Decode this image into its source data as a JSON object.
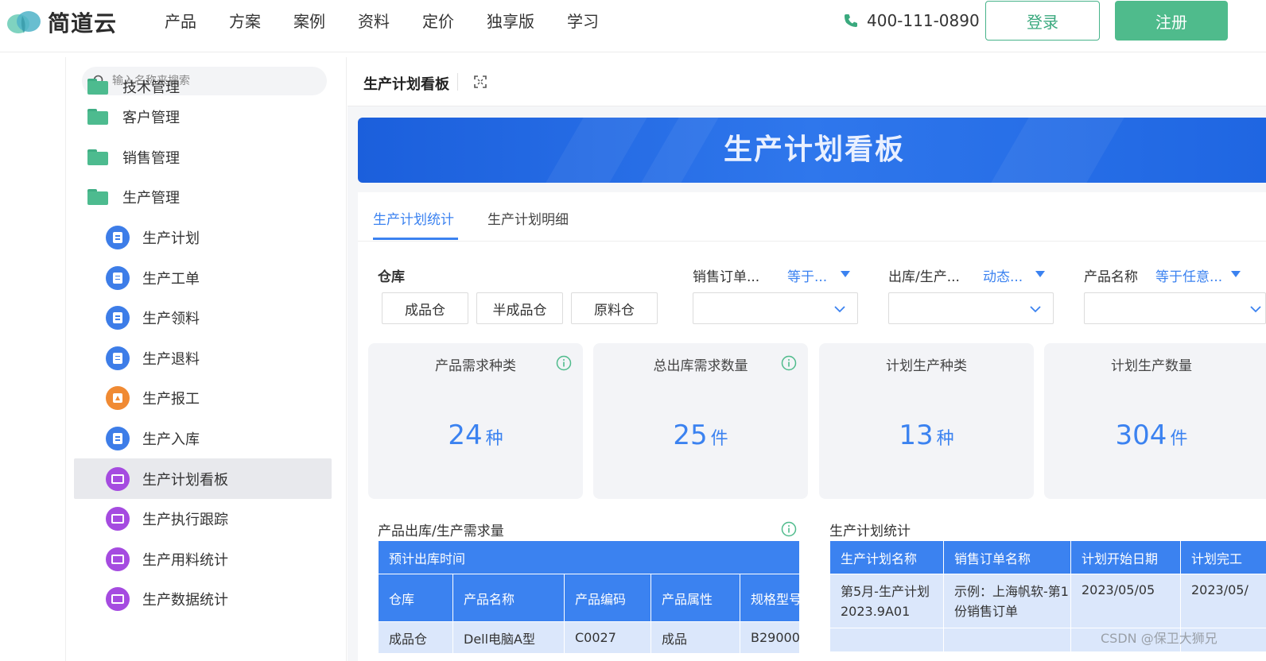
{
  "brand": {
    "name": "简道云"
  },
  "nav": [
    "产品",
    "方案",
    "案例",
    "资料",
    "定价",
    "独享版",
    "学习"
  ],
  "header": {
    "phone": "400-111-0890",
    "login": "登录",
    "register": "注册"
  },
  "sidebar": {
    "search_placeholder": "输入名称来搜索",
    "cutoff_label": "技术管理",
    "folders": [
      "客户管理",
      "销售管理",
      "生产管理"
    ],
    "items": [
      {
        "label": "生产计划",
        "icon": "document-icon",
        "color": "#3d7de8"
      },
      {
        "label": "生产工单",
        "icon": "document-icon",
        "color": "#3d7de8"
      },
      {
        "label": "生产领料",
        "icon": "document-icon",
        "color": "#3d7de8"
      },
      {
        "label": "生产退料",
        "icon": "document-icon",
        "color": "#3d7de8"
      },
      {
        "label": "生产报工",
        "icon": "report-icon",
        "color": "#f08a33"
      },
      {
        "label": "生产入库",
        "icon": "document-icon",
        "color": "#3d7de8"
      },
      {
        "label": "生产计划看板",
        "icon": "dashboard-icon",
        "color": "#a54be0",
        "active": true
      },
      {
        "label": "生产执行跟踪",
        "icon": "dashboard-icon",
        "color": "#a54be0"
      },
      {
        "label": "生产用料统计",
        "icon": "dashboard-icon",
        "color": "#a54be0"
      },
      {
        "label": "生产数据统计",
        "icon": "dashboard-icon",
        "color": "#a54be0"
      }
    ]
  },
  "page": {
    "title": "生产计划看板",
    "banner_title": "生产计划看板",
    "tabs": [
      "生产计划统计",
      "生产计划明细"
    ],
    "active_tab": 0
  },
  "filters": {
    "warehouse_label": "仓库",
    "warehouse_options": [
      "成品仓",
      "半成品仓",
      "原料仓"
    ],
    "sales_order": {
      "label": "销售订单...",
      "op": "等于..."
    },
    "outbound": {
      "label": "出库/生产...",
      "op": "动态..."
    },
    "product_name": {
      "label": "产品名称",
      "op": "等于任意..."
    }
  },
  "cards": [
    {
      "title": "产品需求种类",
      "value": "24",
      "unit": "种",
      "info": true
    },
    {
      "title": "总出库需求数量",
      "value": "25",
      "unit": "件",
      "info": true
    },
    {
      "title": "计划生产种类",
      "value": "13",
      "unit": "种",
      "info": false
    },
    {
      "title": "计划生产数量",
      "value": "304",
      "unit": "件",
      "info": false
    }
  ],
  "left_table": {
    "title": "产品出库/生产需求量",
    "group_header": "预计出库时间",
    "columns": [
      "仓库",
      "产品名称",
      "产品编码",
      "产品属性",
      "规格型号"
    ],
    "rows": [
      [
        "成品仓",
        "Dell电脑A型",
        "C0027",
        "成品",
        "B29000"
      ]
    ]
  },
  "right_table": {
    "title": "生产计划统计",
    "columns": [
      "生产计划名称",
      "销售订单名称",
      "计划开始日期",
      "计划完工"
    ],
    "rows": [
      [
        "第5月-生产计划 2023.9A01",
        "示例：上海帆软-第1份销售订单",
        "2023/05/05",
        "2023/05/"
      ]
    ]
  },
  "watermark": "CSDN @保卫大狮兄"
}
